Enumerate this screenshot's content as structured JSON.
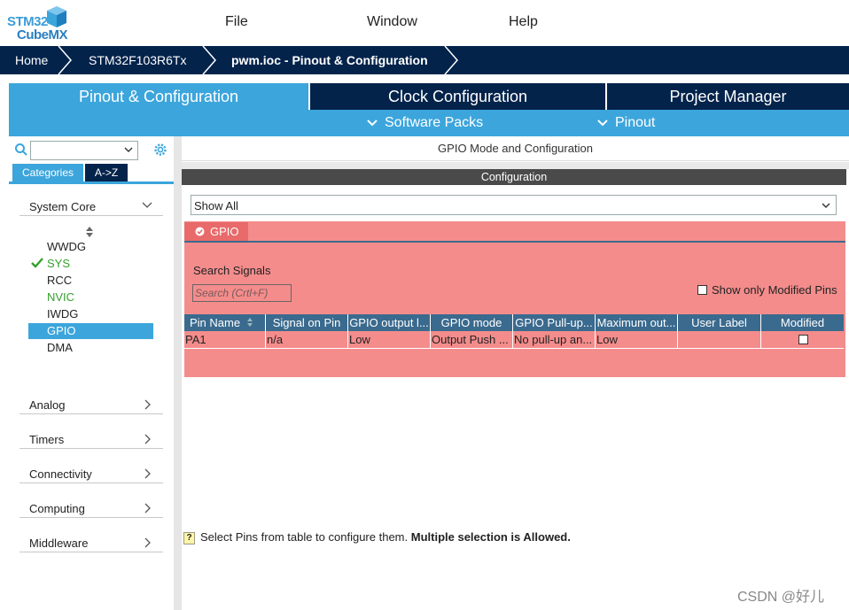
{
  "app": {
    "logo_line1": "STM32",
    "logo_line2": "CubeMX",
    "brand_color": "#03234b",
    "accent_color": "#3ca5dc"
  },
  "menu": {
    "file": "File",
    "window": "Window",
    "help": "Help"
  },
  "breadcrumb": {
    "home": "Home",
    "device": "STM32F103R6Tx",
    "current": "pwm.ioc - Pinout & Configuration"
  },
  "tabs": {
    "pinout": "Pinout & Configuration",
    "clock": "Clock Configuration",
    "project": "Project Manager"
  },
  "subtabs": {
    "software_packs": "Software Packs",
    "pinout": "Pinout"
  },
  "sidebar": {
    "search_value": "",
    "tab_categories": "Categories",
    "tab_az": "A->Z",
    "sections": {
      "system_core": "System Core",
      "analog": "Analog",
      "timers": "Timers",
      "connectivity": "Connectivity",
      "computing": "Computing",
      "middleware": "Middleware"
    },
    "items": [
      {
        "label": "WWDG",
        "state": "normal"
      },
      {
        "label": "SYS",
        "state": "checked"
      },
      {
        "label": "RCC",
        "state": "normal"
      },
      {
        "label": "NVIC",
        "state": "green"
      },
      {
        "label": "IWDG",
        "state": "normal"
      },
      {
        "label": "GPIO",
        "state": "selected"
      },
      {
        "label": "DMA",
        "state": "normal"
      }
    ]
  },
  "main": {
    "header": "GPIO Mode and Configuration",
    "config_bar": "Configuration",
    "filter_value": "Show All",
    "gpio_tab": "GPIO",
    "search_label": "Search Signals",
    "search_placeholder": "Search (Crtl+F)",
    "show_modified_label": "Show only Modified Pins",
    "columns": [
      "Pin Name",
      "Signal on Pin",
      "GPIO output l...",
      "GPIO mode",
      "GPIO Pull-up...",
      "Maximum out...",
      "User Label",
      "Modified"
    ],
    "rows": [
      {
        "pin": "PA1",
        "signal": "n/a",
        "output": "Low",
        "mode": "Output Push ...",
        "pull": "No pull-up an...",
        "speed": "Low",
        "label": "",
        "modified": false
      }
    ],
    "hint_text": "Select Pins from table to configure them.",
    "hint_bold": "Multiple selection is Allowed."
  },
  "watermark": "CSDN @好儿"
}
